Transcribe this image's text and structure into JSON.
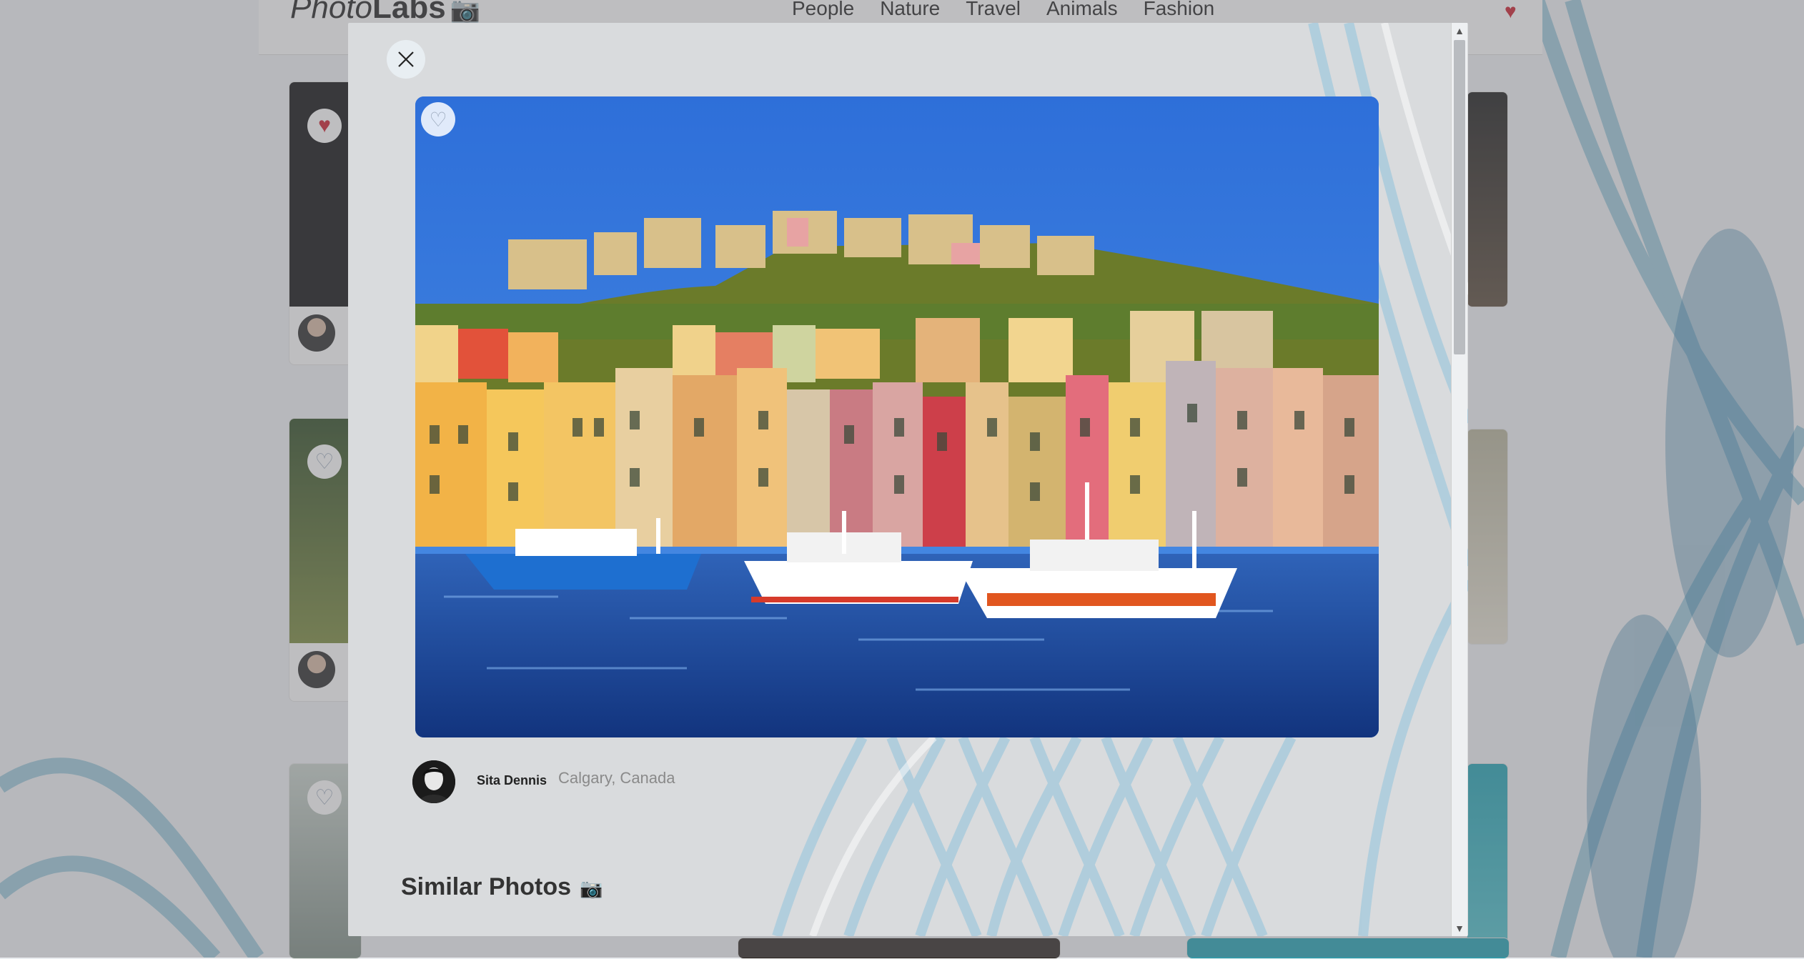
{
  "app": {
    "logo_light": "Photo",
    "logo_bold": "Labs",
    "logo_icon": "camera-icon",
    "topics": [
      "People",
      "Nature",
      "Travel",
      "Animals",
      "Fashion"
    ]
  },
  "modal": {
    "close_icon": "close-icon",
    "favourite_icon": "heart-outline-icon",
    "photo_description": "Colorful harbor town with fishing boats",
    "author": {
      "name": "Sita Dennis",
      "location": "Calgary, Canada"
    },
    "similar_title": "Similar Photos",
    "similar_icon": "camera-icon"
  },
  "colors": {
    "favourite_active": "#cc1d2b",
    "overlay_bg": "#d9dbdd"
  }
}
